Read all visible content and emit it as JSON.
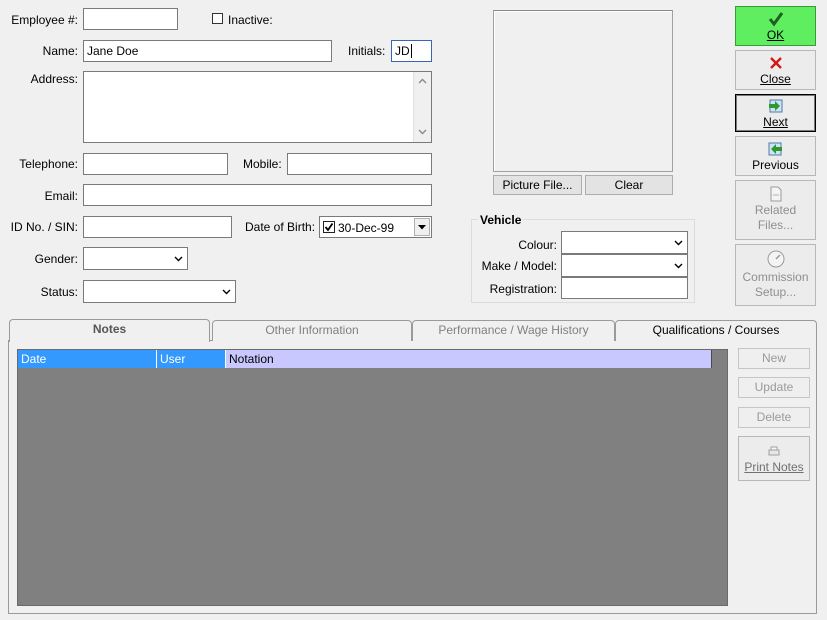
{
  "form": {
    "employee_label": "Employee #:",
    "employee_value": "",
    "inactive_label": "Inactive:",
    "name_label": "Name:",
    "name_value": "Jane Doe",
    "initials_label": "Initials:",
    "initials_value": "JD",
    "address_label": "Address:",
    "telephone_label": "Telephone:",
    "mobile_label": "Mobile:",
    "email_label": "Email:",
    "id_label": "ID No. / SIN:",
    "dob_label": "Date of Birth:",
    "dob_value": "30-Dec-99",
    "dob_checked": true,
    "gender_label": "Gender:",
    "status_label": "Status:"
  },
  "picture": {
    "picture_file_label": "Picture File...",
    "clear_label": "Clear"
  },
  "vehicle": {
    "title": "Vehicle",
    "colour_label": "Colour:",
    "make_label": "Make / Model:",
    "registration_label": "Registration:"
  },
  "sidebar": {
    "ok_label": "OK",
    "close_label": "Close",
    "next_label": "Next",
    "previous_label": "Previous",
    "related_line1": "Related",
    "related_line2": "Files...",
    "commission_line1": "Commission",
    "commission_line2": "Setup..."
  },
  "tabs": [
    {
      "label": "Notes",
      "active": true
    },
    {
      "label": "Other Information",
      "active": false
    },
    {
      "label": "Performance / Wage History",
      "active": false
    },
    {
      "label": "Qualifications / Courses",
      "active": false
    }
  ],
  "notes": {
    "columns": [
      "Date",
      "User",
      "Notation"
    ],
    "new_label": "New",
    "update_label": "Update",
    "delete_label": "Delete",
    "print_label": "Print Notes"
  },
  "colors": {
    "ok_green": "#5fee5f",
    "header_blue": "#3399ff",
    "header_lavender": "#c8c8ff",
    "grid_gray": "#808080"
  }
}
